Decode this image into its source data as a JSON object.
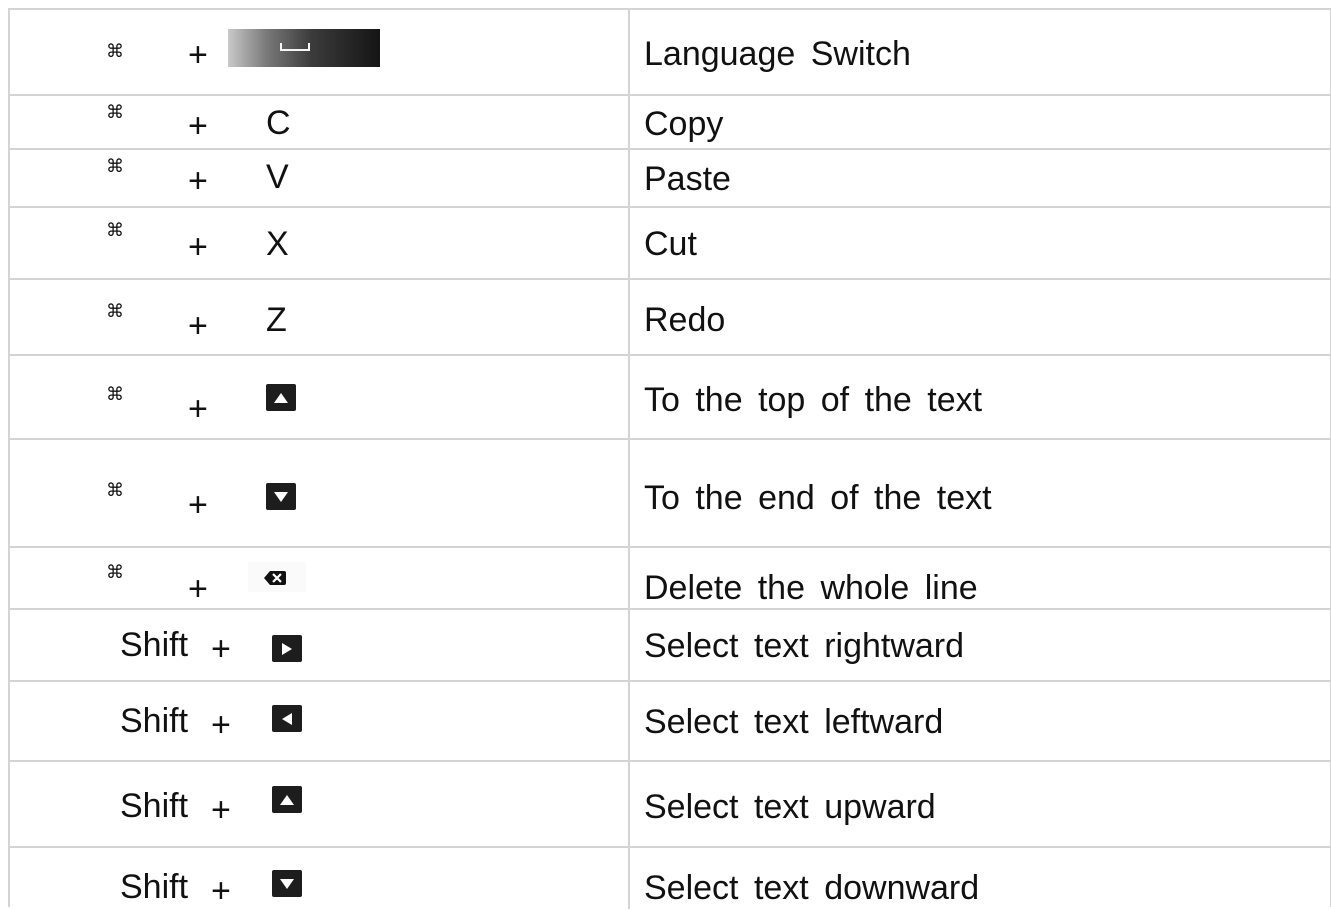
{
  "modifier_glyph": "⌘",
  "plus": "+",
  "shift_label": "Shift",
  "shortcuts": [
    {
      "key": "space",
      "action": "Language  Switch"
    },
    {
      "key": "C",
      "action": "Copy"
    },
    {
      "key": "V",
      "action": "Paste"
    },
    {
      "key": "X",
      "action": "Cut"
    },
    {
      "key": "Z",
      "action": "Redo"
    },
    {
      "key": "up-arrow",
      "action": "To  the  top  of  the  text"
    },
    {
      "key": "down-arrow",
      "action": "To  the  end  of  the  text"
    },
    {
      "key": "backspace",
      "action": "Delete  the  whole  line"
    },
    {
      "key": "right-arrow",
      "action": "Select  text  rightward"
    },
    {
      "key": "left-arrow",
      "action": "Select  text  leftward"
    },
    {
      "key": "up-arrow",
      "action": "Select  text  upward"
    },
    {
      "key": "down-arrow",
      "action": "Select  text  downward"
    }
  ],
  "key_letters": {
    "c": "C",
    "v": "V",
    "x": "X",
    "z": "Z"
  },
  "colors": {
    "grid": "#d4d4d4",
    "keycap": "#1d1d1d",
    "text": "#111111"
  }
}
